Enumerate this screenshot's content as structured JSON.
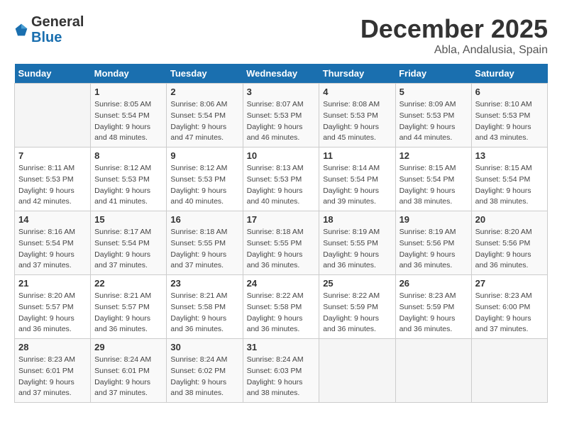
{
  "header": {
    "logo_general": "General",
    "logo_blue": "Blue",
    "month_title": "December 2025",
    "location": "Abla, Andalusia, Spain"
  },
  "days_of_week": [
    "Sunday",
    "Monday",
    "Tuesday",
    "Wednesday",
    "Thursday",
    "Friday",
    "Saturday"
  ],
  "weeks": [
    [
      {
        "day": "",
        "sunrise": "",
        "sunset": "",
        "daylight": ""
      },
      {
        "day": "1",
        "sunrise": "Sunrise: 8:05 AM",
        "sunset": "Sunset: 5:54 PM",
        "daylight": "Daylight: 9 hours and 48 minutes."
      },
      {
        "day": "2",
        "sunrise": "Sunrise: 8:06 AM",
        "sunset": "Sunset: 5:54 PM",
        "daylight": "Daylight: 9 hours and 47 minutes."
      },
      {
        "day": "3",
        "sunrise": "Sunrise: 8:07 AM",
        "sunset": "Sunset: 5:53 PM",
        "daylight": "Daylight: 9 hours and 46 minutes."
      },
      {
        "day": "4",
        "sunrise": "Sunrise: 8:08 AM",
        "sunset": "Sunset: 5:53 PM",
        "daylight": "Daylight: 9 hours and 45 minutes."
      },
      {
        "day": "5",
        "sunrise": "Sunrise: 8:09 AM",
        "sunset": "Sunset: 5:53 PM",
        "daylight": "Daylight: 9 hours and 44 minutes."
      },
      {
        "day": "6",
        "sunrise": "Sunrise: 8:10 AM",
        "sunset": "Sunset: 5:53 PM",
        "daylight": "Daylight: 9 hours and 43 minutes."
      }
    ],
    [
      {
        "day": "7",
        "sunrise": "Sunrise: 8:11 AM",
        "sunset": "Sunset: 5:53 PM",
        "daylight": "Daylight: 9 hours and 42 minutes."
      },
      {
        "day": "8",
        "sunrise": "Sunrise: 8:12 AM",
        "sunset": "Sunset: 5:53 PM",
        "daylight": "Daylight: 9 hours and 41 minutes."
      },
      {
        "day": "9",
        "sunrise": "Sunrise: 8:12 AM",
        "sunset": "Sunset: 5:53 PM",
        "daylight": "Daylight: 9 hours and 40 minutes."
      },
      {
        "day": "10",
        "sunrise": "Sunrise: 8:13 AM",
        "sunset": "Sunset: 5:53 PM",
        "daylight": "Daylight: 9 hours and 40 minutes."
      },
      {
        "day": "11",
        "sunrise": "Sunrise: 8:14 AM",
        "sunset": "Sunset: 5:54 PM",
        "daylight": "Daylight: 9 hours and 39 minutes."
      },
      {
        "day": "12",
        "sunrise": "Sunrise: 8:15 AM",
        "sunset": "Sunset: 5:54 PM",
        "daylight": "Daylight: 9 hours and 38 minutes."
      },
      {
        "day": "13",
        "sunrise": "Sunrise: 8:15 AM",
        "sunset": "Sunset: 5:54 PM",
        "daylight": "Daylight: 9 hours and 38 minutes."
      }
    ],
    [
      {
        "day": "14",
        "sunrise": "Sunrise: 8:16 AM",
        "sunset": "Sunset: 5:54 PM",
        "daylight": "Daylight: 9 hours and 37 minutes."
      },
      {
        "day": "15",
        "sunrise": "Sunrise: 8:17 AM",
        "sunset": "Sunset: 5:54 PM",
        "daylight": "Daylight: 9 hours and 37 minutes."
      },
      {
        "day": "16",
        "sunrise": "Sunrise: 8:18 AM",
        "sunset": "Sunset: 5:55 PM",
        "daylight": "Daylight: 9 hours and 37 minutes."
      },
      {
        "day": "17",
        "sunrise": "Sunrise: 8:18 AM",
        "sunset": "Sunset: 5:55 PM",
        "daylight": "Daylight: 9 hours and 36 minutes."
      },
      {
        "day": "18",
        "sunrise": "Sunrise: 8:19 AM",
        "sunset": "Sunset: 5:55 PM",
        "daylight": "Daylight: 9 hours and 36 minutes."
      },
      {
        "day": "19",
        "sunrise": "Sunrise: 8:19 AM",
        "sunset": "Sunset: 5:56 PM",
        "daylight": "Daylight: 9 hours and 36 minutes."
      },
      {
        "day": "20",
        "sunrise": "Sunrise: 8:20 AM",
        "sunset": "Sunset: 5:56 PM",
        "daylight": "Daylight: 9 hours and 36 minutes."
      }
    ],
    [
      {
        "day": "21",
        "sunrise": "Sunrise: 8:20 AM",
        "sunset": "Sunset: 5:57 PM",
        "daylight": "Daylight: 9 hours and 36 minutes."
      },
      {
        "day": "22",
        "sunrise": "Sunrise: 8:21 AM",
        "sunset": "Sunset: 5:57 PM",
        "daylight": "Daylight: 9 hours and 36 minutes."
      },
      {
        "day": "23",
        "sunrise": "Sunrise: 8:21 AM",
        "sunset": "Sunset: 5:58 PM",
        "daylight": "Daylight: 9 hours and 36 minutes."
      },
      {
        "day": "24",
        "sunrise": "Sunrise: 8:22 AM",
        "sunset": "Sunset: 5:58 PM",
        "daylight": "Daylight: 9 hours and 36 minutes."
      },
      {
        "day": "25",
        "sunrise": "Sunrise: 8:22 AM",
        "sunset": "Sunset: 5:59 PM",
        "daylight": "Daylight: 9 hours and 36 minutes."
      },
      {
        "day": "26",
        "sunrise": "Sunrise: 8:23 AM",
        "sunset": "Sunset: 5:59 PM",
        "daylight": "Daylight: 9 hours and 36 minutes."
      },
      {
        "day": "27",
        "sunrise": "Sunrise: 8:23 AM",
        "sunset": "Sunset: 6:00 PM",
        "daylight": "Daylight: 9 hours and 37 minutes."
      }
    ],
    [
      {
        "day": "28",
        "sunrise": "Sunrise: 8:23 AM",
        "sunset": "Sunset: 6:01 PM",
        "daylight": "Daylight: 9 hours and 37 minutes."
      },
      {
        "day": "29",
        "sunrise": "Sunrise: 8:24 AM",
        "sunset": "Sunset: 6:01 PM",
        "daylight": "Daylight: 9 hours and 37 minutes."
      },
      {
        "day": "30",
        "sunrise": "Sunrise: 8:24 AM",
        "sunset": "Sunset: 6:02 PM",
        "daylight": "Daylight: 9 hours and 38 minutes."
      },
      {
        "day": "31",
        "sunrise": "Sunrise: 8:24 AM",
        "sunset": "Sunset: 6:03 PM",
        "daylight": "Daylight: 9 hours and 38 minutes."
      },
      {
        "day": "",
        "sunrise": "",
        "sunset": "",
        "daylight": ""
      },
      {
        "day": "",
        "sunrise": "",
        "sunset": "",
        "daylight": ""
      },
      {
        "day": "",
        "sunrise": "",
        "sunset": "",
        "daylight": ""
      }
    ]
  ]
}
